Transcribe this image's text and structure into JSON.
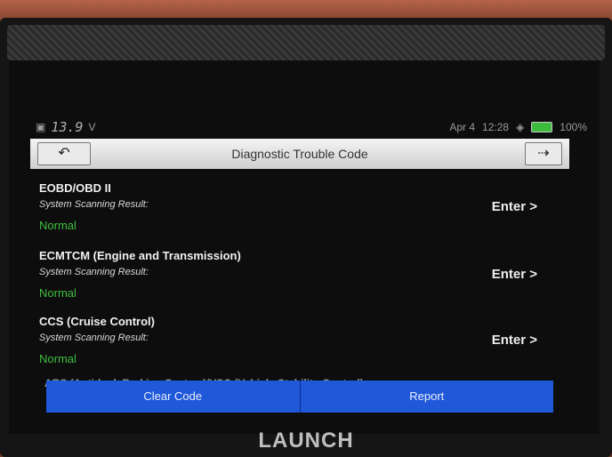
{
  "status": {
    "voltage": "13.9",
    "voltage_unit": "V",
    "date": "Apr 4",
    "time": "12:28",
    "battery": "100%",
    "icons": [
      "car-battery-icon",
      "wifi-icon",
      "battery-icon"
    ]
  },
  "header": {
    "title": "Diagnostic Trouble Code",
    "back_icon": "back-arrow-icon",
    "exit_icon": "exit-icon"
  },
  "systems": [
    {
      "name": "EOBD/OBD II",
      "subtitle": "System Scanning Result:",
      "status": "Normal",
      "action": "Enter >"
    },
    {
      "name": "ECMTCM (Engine and Transmission)",
      "subtitle": "System Scanning Result:",
      "status": "Normal",
      "action": "Enter >"
    },
    {
      "name": "CCS (Cruise Control)",
      "subtitle": "System Scanning Result:",
      "status": "Normal",
      "action": "Enter >"
    }
  ],
  "partial_item": "ABS (Anti-lock Braking System)/VSC (Vehicle Stability Control)",
  "actions": {
    "clear_code": "Clear Code",
    "report": "Report"
  },
  "brand": "LAUNCH",
  "colors": {
    "accent": "#1f58d8",
    "status_ok": "#3fbf3f",
    "battery": "#3dbb3d"
  }
}
